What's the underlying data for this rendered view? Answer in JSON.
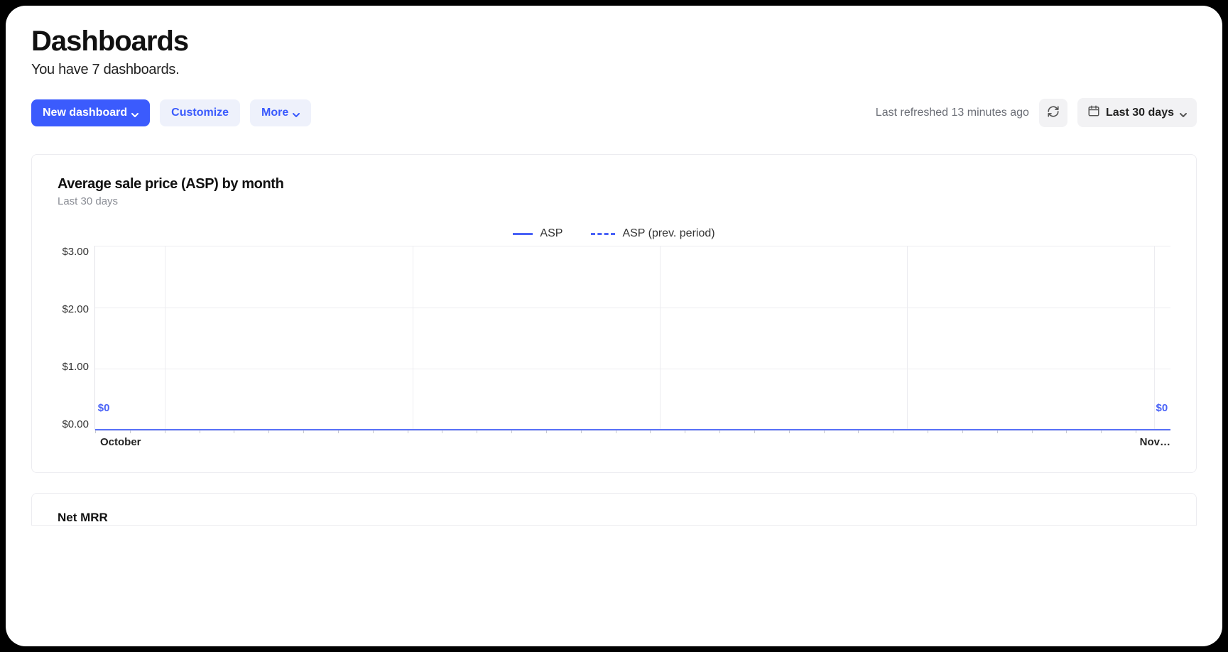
{
  "header": {
    "title": "Dashboards",
    "subtitle": "You have 7 dashboards."
  },
  "toolbar": {
    "new_dashboard_label": "New dashboard",
    "customize_label": "Customize",
    "more_label": "More",
    "last_refreshed": "Last refreshed 13 minutes ago",
    "date_range_label": "Last 30 days"
  },
  "card_asp": {
    "title": "Average sale price (ASP) by month",
    "subtitle": "Last 30 days",
    "legend_asp": "ASP",
    "legend_prev": "ASP (prev. period)",
    "y_ticks": [
      "$3.00",
      "$2.00",
      "$1.00",
      "$0.00"
    ],
    "x_start": "October",
    "x_end": "Nov…",
    "pt_start": "$0",
    "pt_end": "$0"
  },
  "card_mrr": {
    "title": "Net MRR"
  },
  "chart_data": {
    "type": "line",
    "title": "Average sale price (ASP) by month",
    "xlabel": "",
    "ylabel": "",
    "ylim": [
      0,
      3
    ],
    "y_ticks": [
      0,
      1,
      2,
      3
    ],
    "x_range": [
      "October",
      "November"
    ],
    "series": [
      {
        "name": "ASP",
        "style": "solid",
        "values": [
          0,
          0
        ]
      },
      {
        "name": "ASP (prev. period)",
        "style": "dashed",
        "values": [
          0,
          0
        ]
      }
    ],
    "point_labels": [
      {
        "x": "October",
        "label": "$0"
      },
      {
        "x": "November",
        "label": "$0"
      }
    ]
  }
}
